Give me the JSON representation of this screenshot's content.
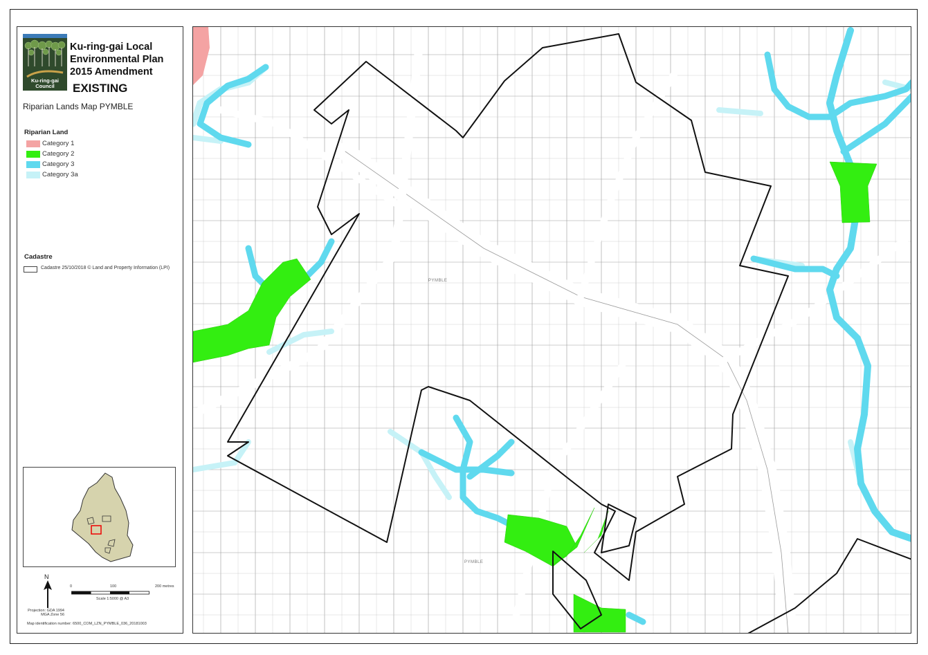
{
  "header": {
    "council_name": "Ku-ring-gai Council",
    "plan_title": "Ku-ring-gai Local Environmental Plan 2015 Amendment",
    "status": "EXISTING",
    "map_title": "Riparian Lands Map PYMBLE"
  },
  "legend": {
    "riparian_heading": "Riparian Land",
    "riparian_items": [
      {
        "label": "Category 1",
        "color": "#f4a3a3"
      },
      {
        "label": "Category 2",
        "color": "#33ee11"
      },
      {
        "label": "Category 3",
        "color": "#5fd9ee"
      },
      {
        "label": "Category 3a",
        "color": "#c6f2f7"
      }
    ],
    "cadastre_heading": "Cadastre",
    "cadastre_label": "Cadastre 25/10/2018 © Land and Property Information (LPI)"
  },
  "scale": {
    "tick_labels": [
      "0",
      "100",
      "200 metres"
    ],
    "scale_text": "Scale 1:5000 @ A3"
  },
  "north_label": "N",
  "projection": "Projection: GDA 1994 MGA Zone 56",
  "map_id": "Map identification number: 6500_COM_LZN_PYMBLE_036_20181003",
  "map": {
    "suburb_labels": [
      "PYMBLE",
      "PYMBLE"
    ]
  }
}
